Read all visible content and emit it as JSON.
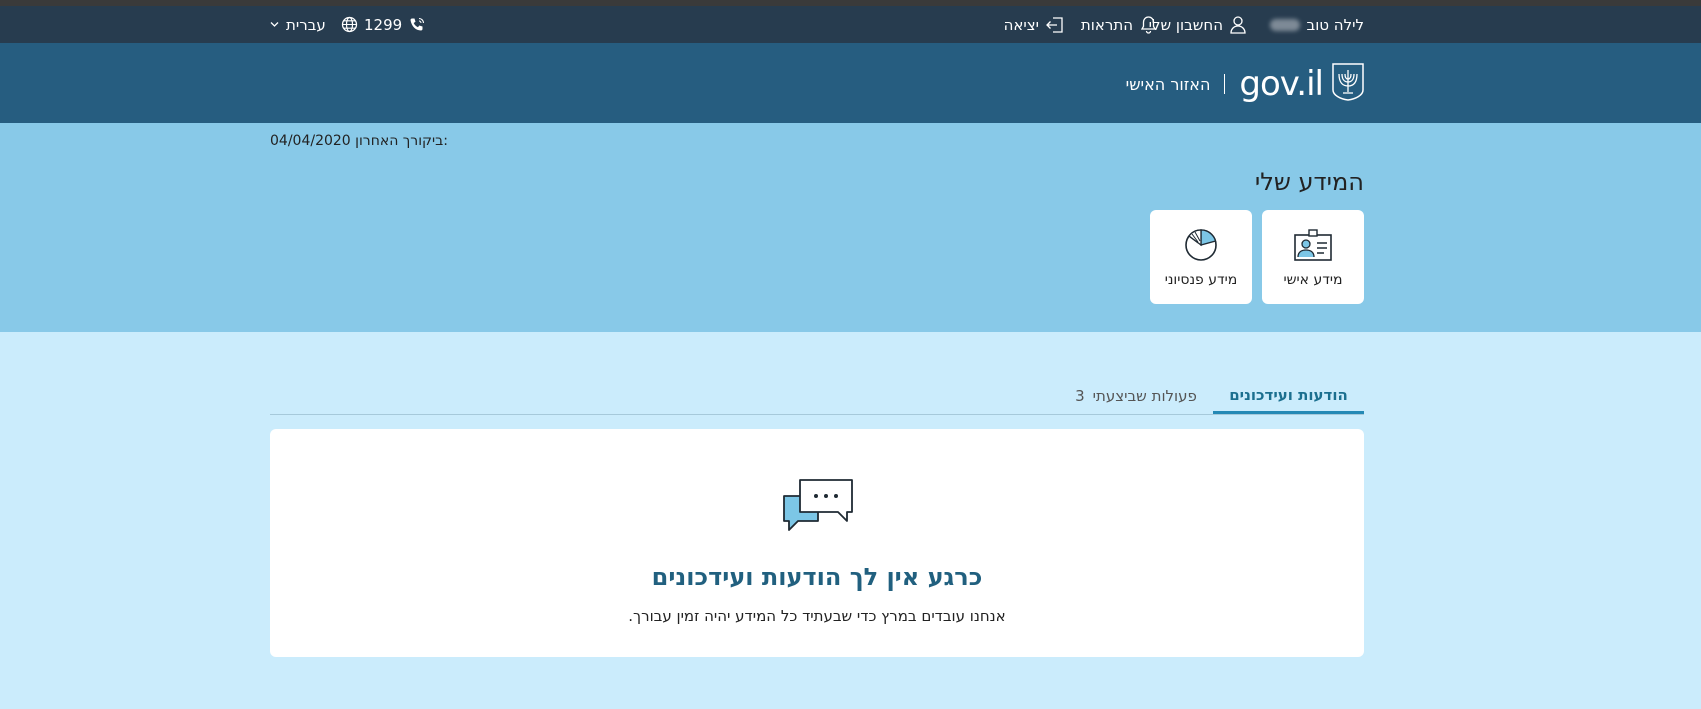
{
  "topbar": {
    "greeting": "לילה טוב",
    "my_account": "החשבון שלי",
    "alerts": "התראות",
    "logout": "יציאה",
    "phone": "1299",
    "language": "עברית"
  },
  "nav": {
    "logo_text": "gov.il",
    "personal_area": "האזור האישי"
  },
  "hero": {
    "last_visit_label": "ביקורך האחרון:",
    "last_visit_date": "04/04/2020",
    "title": "המידע שלי",
    "cards": [
      {
        "label": "מידע אישי",
        "icon": "id-card-icon"
      },
      {
        "label": "מידע פנסיוני",
        "icon": "pie-chart-icon"
      }
    ]
  },
  "tabs": [
    {
      "label": "הודעות ועידכונים",
      "active": true
    },
    {
      "label": "פעולות שביצעתי",
      "count": "3",
      "active": false
    }
  ],
  "empty_state": {
    "icon": "chat-bubbles-icon",
    "title": "כרגע אין לך הודעות ועידכונים",
    "subtitle": "אנחנו עובדים במרץ כדי שבעתיד כל המידע יהיה זמין עבורך."
  },
  "colors": {
    "topbar_bg": "#273c4f",
    "navbar_bg": "#265d80",
    "hero_bg": "#88c9e8",
    "page_bg": "#cbecfc",
    "accent": "#1b6f8f"
  }
}
